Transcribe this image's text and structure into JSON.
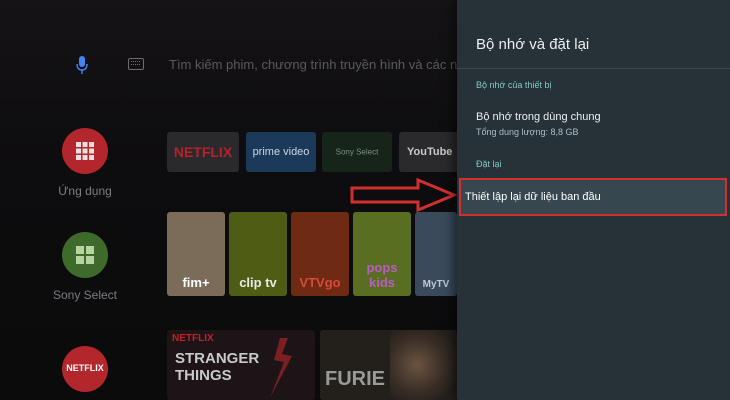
{
  "search": {
    "placeholder": "Tìm kiếm phim, chương trình truyền hình và các nội d"
  },
  "apps_column": [
    {
      "label": "Ứng dụng",
      "icon": "apps-grid-icon"
    },
    {
      "label": "Sony Select",
      "icon": "sony-select-icon"
    },
    {
      "label": "NETFLIX",
      "icon": "netflix-icon"
    }
  ],
  "app_tiles": [
    "NETFLIX",
    "prime video",
    "Sony Select",
    "YouTube"
  ],
  "thumb_row": [
    "fim+",
    "clip tv",
    "VTVgo",
    "pops kids",
    "MyTV"
  ],
  "bottom_row": {
    "netflix_label": "NETFLIX",
    "stranger_things": "STRANGER THINGS",
    "furie": "FURIE"
  },
  "panel": {
    "title": "Bộ nhớ và đặt lại",
    "device_storage_header": "Bộ nhớ của thiết bị",
    "shared_storage_title": "Bộ nhớ trong dùng chung",
    "shared_storage_subtitle": "Tổng dung lượng: 8,8 GB",
    "reset_header": "Đặt lại",
    "factory_reset_label": "Thiết lập lại dữ liệu ban đầu"
  },
  "colors": {
    "panel_bg": "#263238",
    "accent": "#80cbc4",
    "highlight_border": "#d32f2f",
    "netflix_red": "#e50914"
  }
}
